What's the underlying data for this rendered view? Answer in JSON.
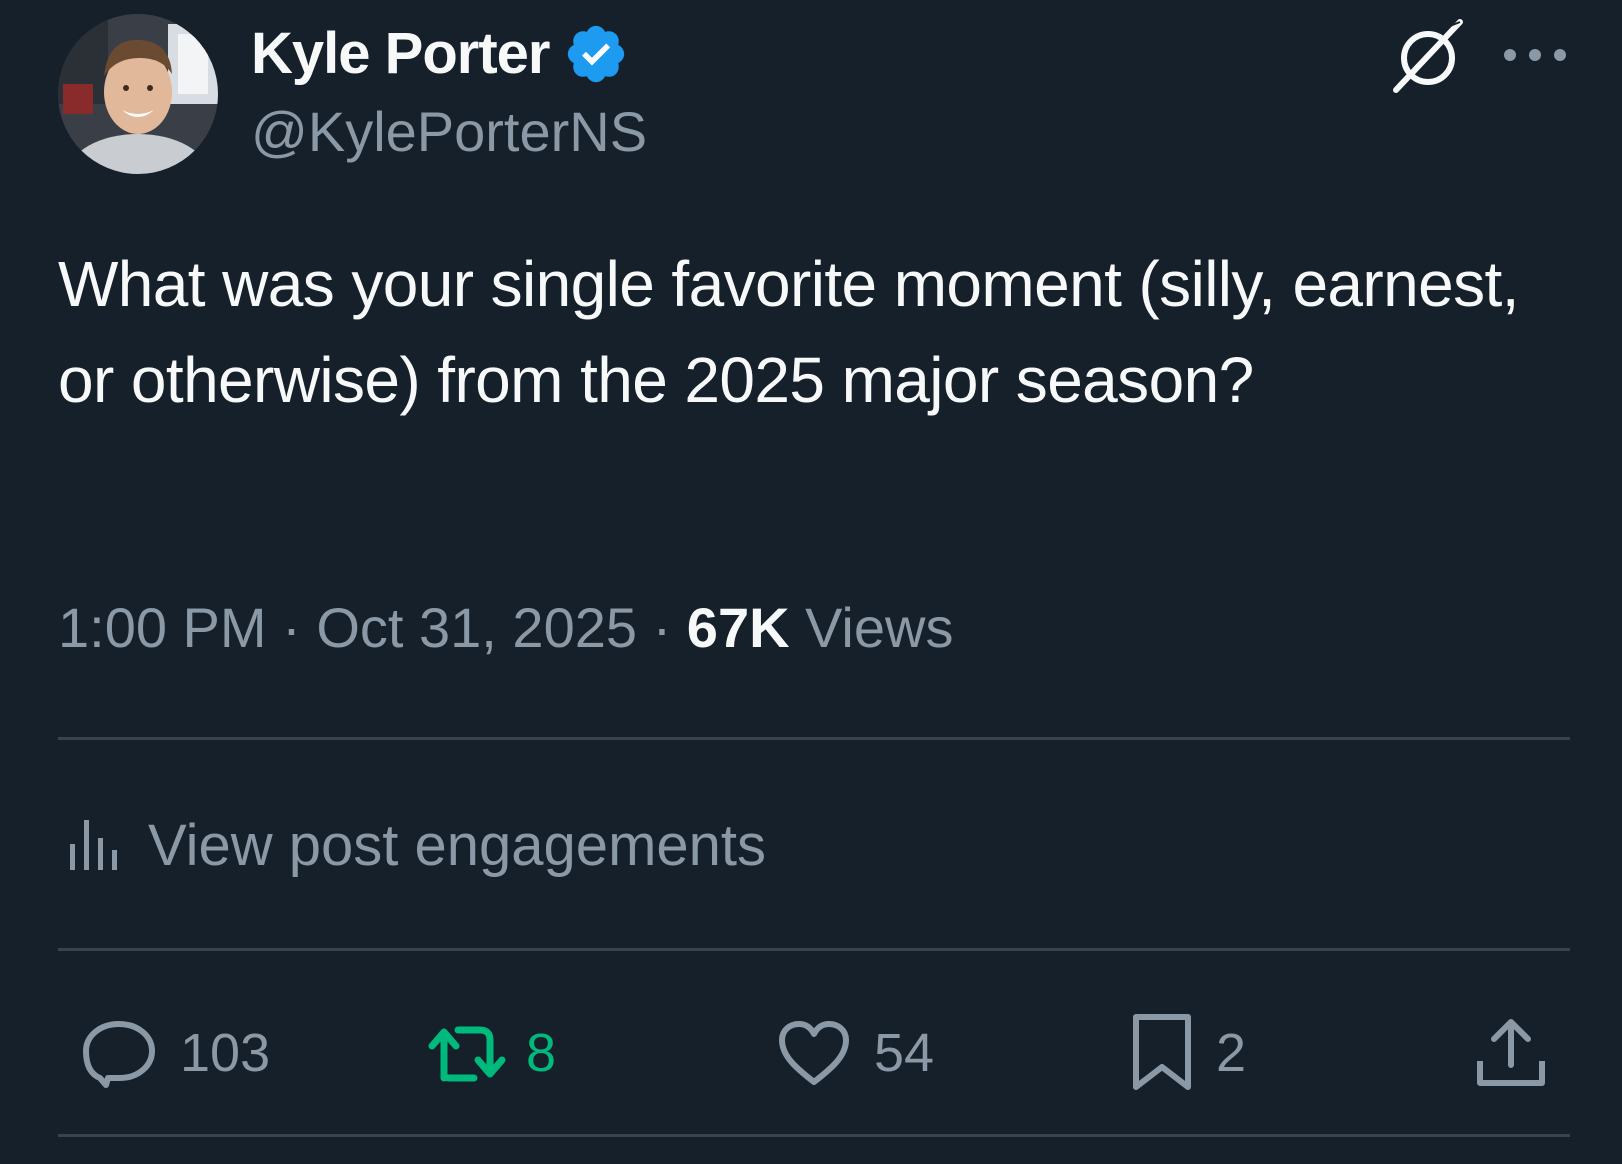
{
  "author": {
    "display_name": "Kyle Porter",
    "handle": "@KylePorterNS",
    "verified": true,
    "badge_color": "#1d9bf0"
  },
  "header": {
    "grok_icon": "grok-slash-circle-icon",
    "more_icon": "more-horizontal-icon"
  },
  "tweet": {
    "text": "What was your single favorite moment (silly, earnest, or otherwise) from the 2025 major season?"
  },
  "meta": {
    "time": "1:00 PM",
    "separator": "·",
    "date": "Oct 31, 2025",
    "views_count": "67K",
    "views_label": "Views"
  },
  "engagements": {
    "label": "View post engagements",
    "icon": "bar-chart-icon"
  },
  "actions": {
    "reply_count": "103",
    "retweet_count": "8",
    "like_count": "54",
    "bookmark_count": "2",
    "retweet_color": "#00ba7c",
    "muted_color": "#8b98a5"
  },
  "colors": {
    "background": "#15202b",
    "text_primary": "#f7f9f9",
    "text_secondary": "#8b98a5",
    "divider": "#38444d"
  }
}
